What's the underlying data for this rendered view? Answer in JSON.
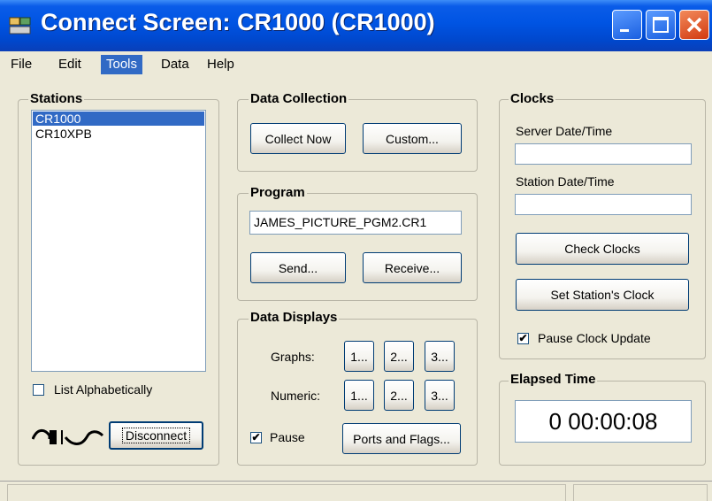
{
  "window": {
    "title": "Connect Screen: CR1000 (CR1000)"
  },
  "menu": [
    "File",
    "Edit",
    "Tools",
    "Data",
    "Help"
  ],
  "stations": {
    "title": "Stations",
    "items": [
      "CR1000",
      "CR10XPB"
    ],
    "list_alpha_label": "List Alphabetically",
    "disconnect_label": "Disconnect"
  },
  "data_collection": {
    "title": "Data Collection",
    "collect_now": "Collect Now",
    "custom": "Custom..."
  },
  "program": {
    "title": "Program",
    "file": "JAMES_PICTURE_PGM2.CR1",
    "send": "Send...",
    "receive": "Receive..."
  },
  "data_displays": {
    "title": "Data Displays",
    "graphs_label": "Graphs:",
    "numeric_label": "Numeric:",
    "btn1": "1...",
    "btn2": "2...",
    "btn3": "3...",
    "pause_label": "Pause",
    "ports_flags": "Ports and Flags..."
  },
  "clocks": {
    "title": "Clocks",
    "server_label": "Server Date/Time",
    "station_label": "Station Date/Time",
    "check_clocks": "Check Clocks",
    "set_clock": "Set Station's Clock",
    "pause_update": "Pause Clock Update"
  },
  "elapsed": {
    "title": "Elapsed Time",
    "value": "0 00:00:08"
  },
  "colors": {
    "titlebar": "#0054e3",
    "selection": "#316ac5",
    "background": "#ece9d8"
  }
}
